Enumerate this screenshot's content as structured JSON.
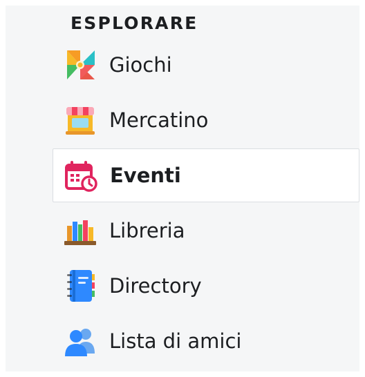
{
  "section_title": "ESPLORARE",
  "items": [
    {
      "label": "Giochi",
      "icon": "pinwheel-icon"
    },
    {
      "label": "Mercatino",
      "icon": "storefront-icon"
    },
    {
      "label": "Eventi",
      "icon": "calendar-clock-icon",
      "selected": true
    },
    {
      "label": "Libreria",
      "icon": "books-icon"
    },
    {
      "label": "Directory",
      "icon": "address-book-icon"
    },
    {
      "label": "Lista di amici",
      "icon": "friends-icon"
    }
  ],
  "colors": {
    "panel_bg": "#f5f6f7",
    "text": "#1c1e21",
    "selected_bg": "#ffffff",
    "selected_border": "#dadde1",
    "friends_blue": "#4a90e2"
  }
}
